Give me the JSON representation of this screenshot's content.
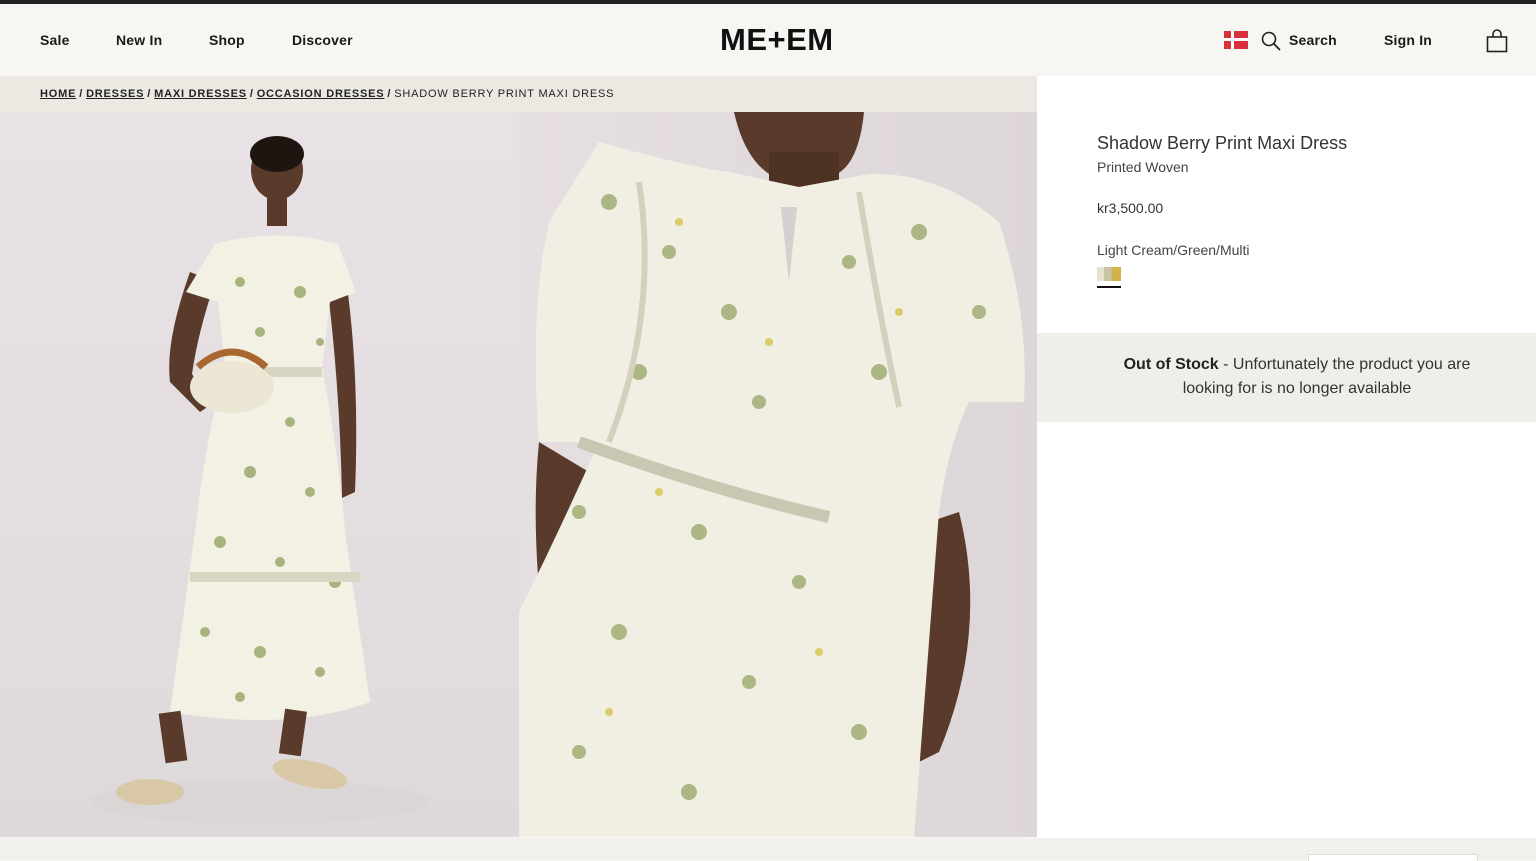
{
  "brand": {
    "logo": "ME+EM"
  },
  "nav": {
    "items": [
      {
        "label": "Sale"
      },
      {
        "label": "New In"
      },
      {
        "label": "Shop"
      },
      {
        "label": "Discover"
      }
    ],
    "search_label": "Search",
    "signin_label": "Sign In",
    "flag_icon": "denmark-flag-icon",
    "search_icon": "search-icon",
    "bag_icon": "shopping-bag-icon"
  },
  "breadcrumb": {
    "links": [
      "HOME",
      "DRESSES",
      "MAXI DRESSES",
      "OCCASION DRESSES"
    ],
    "current": "SHADOW BERRY PRINT MAXI DRESS"
  },
  "product": {
    "title": "Shadow Berry Print Maxi Dress",
    "subtitle": "Printed Woven",
    "price": "kr3,500.00",
    "color_name": "Light Cream/Green/Multi",
    "stock_status": "Out of Stock",
    "stock_message": " - Unfortunately the product you are looking for is no longer available"
  },
  "colors": {
    "accent": "#1a1a1a",
    "flag_red": "#d9313b",
    "oos_bg": "#f0eee9",
    "breadcrumb_bg": "#ebe9e2"
  }
}
